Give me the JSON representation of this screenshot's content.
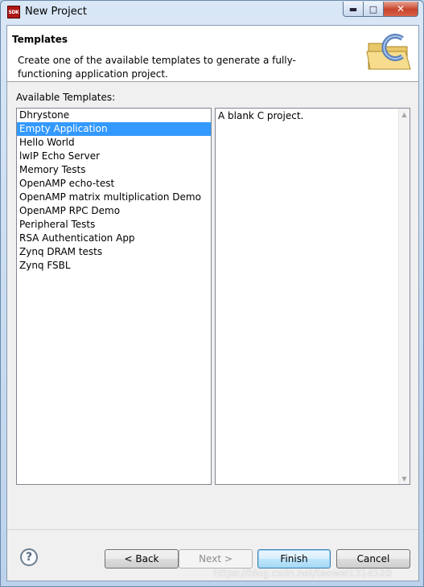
{
  "window": {
    "title": "New Project",
    "app_icon_text": "SDK"
  },
  "banner": {
    "title": "Templates",
    "description": "Create one of the available templates to generate a fully-functioning application project."
  },
  "templates": {
    "label": "Available Templates:",
    "items": [
      "Dhrystone",
      "Empty Application",
      "Hello World",
      "lwIP Echo Server",
      "Memory Tests",
      "OpenAMP echo-test",
      "OpenAMP matrix multiplication Demo",
      "OpenAMP RPC Demo",
      "Peripheral Tests",
      "RSA Authentication App",
      "Zynq DRAM tests",
      "Zynq FSBL"
    ],
    "selected_index": 1
  },
  "description_panel": {
    "text": "A blank C project."
  },
  "buttons": {
    "help": "?",
    "back": "< Back",
    "next": "Next >",
    "finish": "Finish",
    "cancel": "Cancel"
  },
  "watermark": "https://blog.csdn.net/taowei1314520",
  "colors": {
    "selection": "#3399ff",
    "dialog_bg": "#f0f0f0"
  }
}
